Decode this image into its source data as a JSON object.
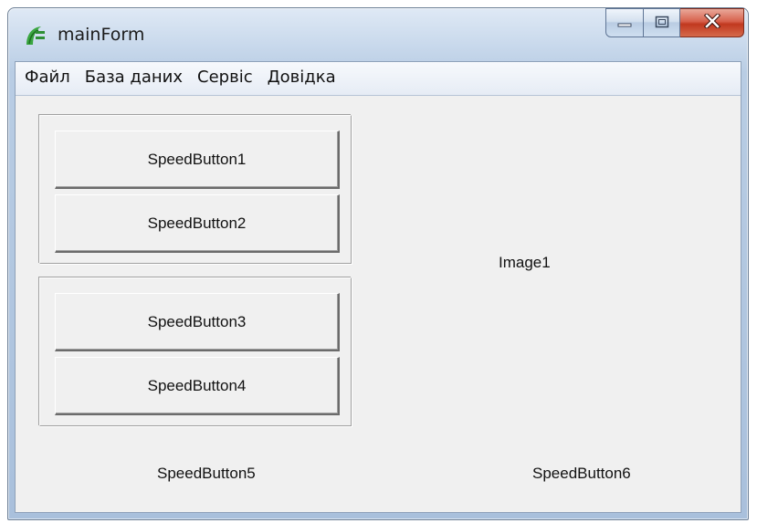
{
  "window": {
    "title": "mainForm"
  },
  "menu": {
    "items": [
      "Файл",
      "База даних",
      "Сервіс",
      "Довідка"
    ]
  },
  "panel1": {
    "buttons": [
      "SpeedButton1",
      "SpeedButton2"
    ]
  },
  "panel2": {
    "buttons": [
      "SpeedButton3",
      "SpeedButton4"
    ]
  },
  "image": {
    "label": "Image1"
  },
  "bottom": {
    "button5": "SpeedButton5",
    "button6": "SpeedButton6"
  },
  "icons": {
    "app": "app-logo-icon",
    "minimize": "minimize-icon",
    "maximize": "maximize-icon",
    "close": "close-icon"
  },
  "colors": {
    "close_button": "#c7402a",
    "window_face": "#f0f0f0"
  }
}
